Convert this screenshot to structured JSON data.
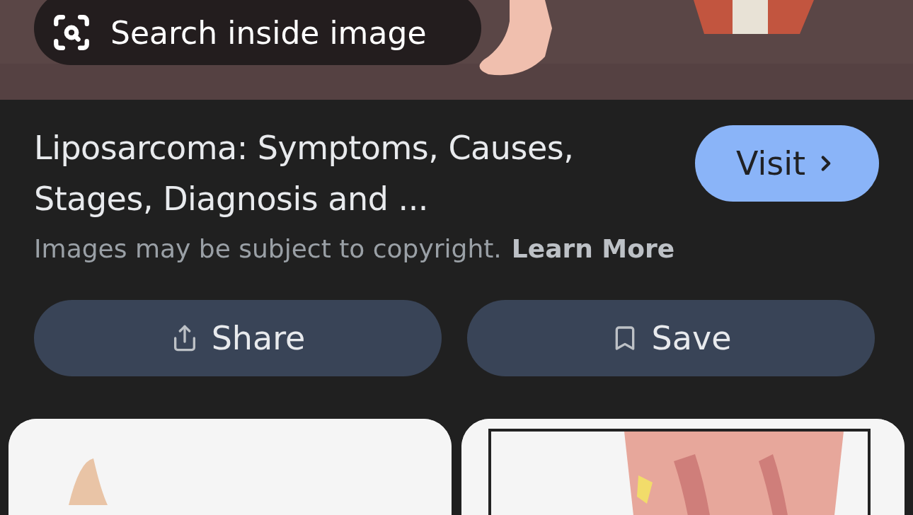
{
  "hero": {
    "kind": "picture",
    "search_button": "Search inside image"
  },
  "result": {
    "title": "Liposarcoma: Symptoms, Causes, Stages, Diagnosis and ...",
    "visit_button": "Visit",
    "notice": "Images may be subject to copyright.",
    "notice_link": "Learn More"
  },
  "actions": [
    {
      "kind": "share",
      "label": "Share"
    },
    {
      "kind": "save",
      "label": "Save"
    }
  ]
}
